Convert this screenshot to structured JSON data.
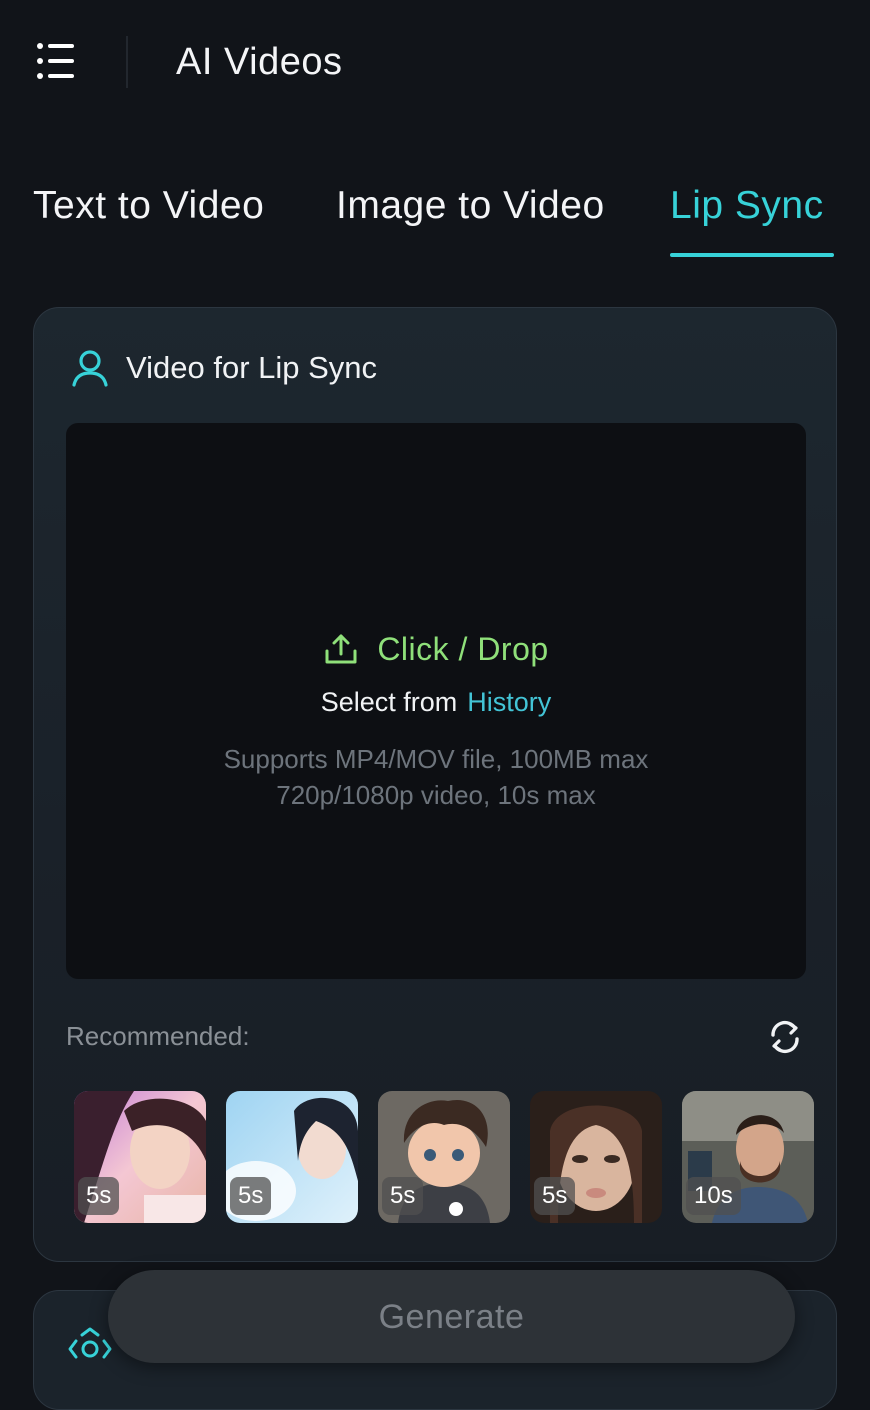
{
  "header": {
    "menu_icon": "hamburger-menu-icon",
    "title": "AI Videos"
  },
  "tabs": [
    {
      "label": "Text to Video",
      "active": false
    },
    {
      "label": "Image to Video",
      "active": false
    },
    {
      "label": "Lip Sync",
      "active": true
    }
  ],
  "lip_sync_card": {
    "icon": "person-outline-icon",
    "title": "Video for Lip Sync",
    "upload": {
      "icon": "upload-icon",
      "primary": "Click / Drop",
      "select_prefix": "Select from",
      "select_link": "History",
      "hint_line1": "Supports MP4/MOV file, 100MB max",
      "hint_line2": "720p/1080p video, 10s max"
    },
    "recommended": {
      "label": "Recommended:",
      "refresh_icon": "refresh-icon",
      "items": [
        {
          "duration": "5s"
        },
        {
          "duration": "5s"
        },
        {
          "duration": "5s"
        },
        {
          "duration": "5s"
        },
        {
          "duration": "10s"
        }
      ]
    }
  },
  "generate": {
    "label": "Generate"
  },
  "colors": {
    "background": "#111419",
    "accent": "#37d2d8",
    "upload_green": "#8fe07a",
    "link": "#43c4d6"
  }
}
